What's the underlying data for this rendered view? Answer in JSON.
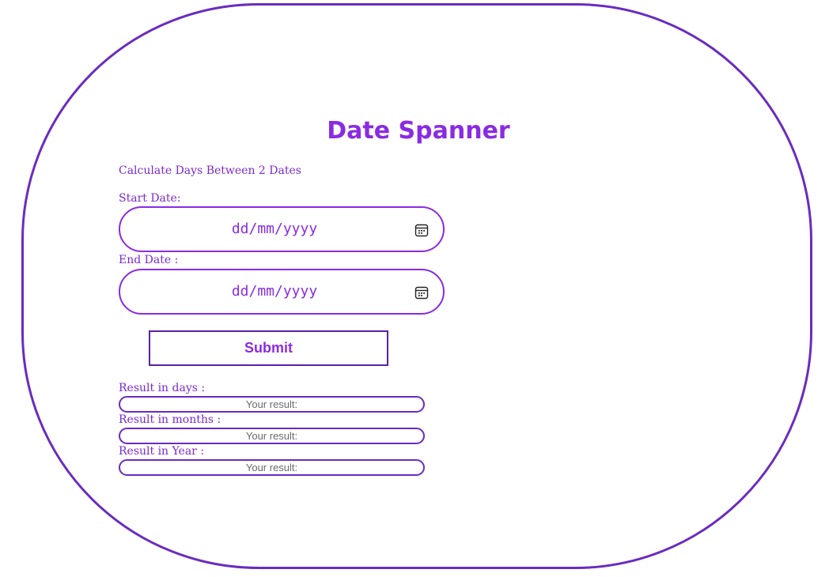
{
  "title": "Date Spanner",
  "subtitle": "Calculate Days Between 2 Dates",
  "start": {
    "label": "Start Date:",
    "placeholder": "dd/mm/yyyy"
  },
  "end": {
    "label": "End Date :",
    "placeholder": "dd/mm/yyyy"
  },
  "submit_label": "Submit",
  "results": [
    {
      "label": "Result in days :",
      "placeholder": "Your result:"
    },
    {
      "label": "Result in months :",
      "placeholder": "Your result:"
    },
    {
      "label": "Result in Year :",
      "placeholder": "Your result:"
    }
  ],
  "icons": {
    "calendar": "calendar-icon"
  },
  "colors": {
    "accent": "#8a2be2",
    "border": "#6a2bc0"
  }
}
